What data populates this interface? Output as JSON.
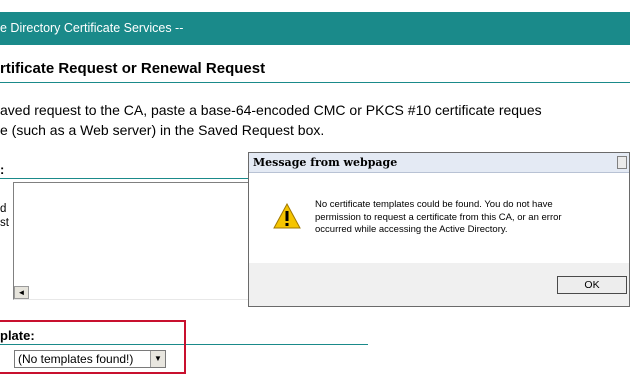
{
  "header": {
    "title": "e Directory Certificate Services  --"
  },
  "section": {
    "title": "rtificate Request or Renewal Request"
  },
  "instructions": {
    "line1": "aved request to the CA, paste a base-64-encoded CMC or PKCS #10 certificate reques",
    "line2": "e (such as a Web server) in the Saved Request box."
  },
  "saved_request": {
    "heading": ":",
    "side_label_line1": "d",
    "side_label_line2": "st"
  },
  "template": {
    "label": "plate:",
    "selected": "(No templates found!)"
  },
  "dialog": {
    "title": "Message from webpage",
    "message_lines": [
      "No certificate templates could be found. You do not have",
      "permission to request a certificate from this CA, or an error",
      "occurred while accessing the Active Directory."
    ],
    "ok_label": "OK",
    "icon": "warning-icon"
  },
  "colors": {
    "header": "#1a8a8a",
    "highlight": "#c8102e",
    "warning": "#f5c400"
  }
}
